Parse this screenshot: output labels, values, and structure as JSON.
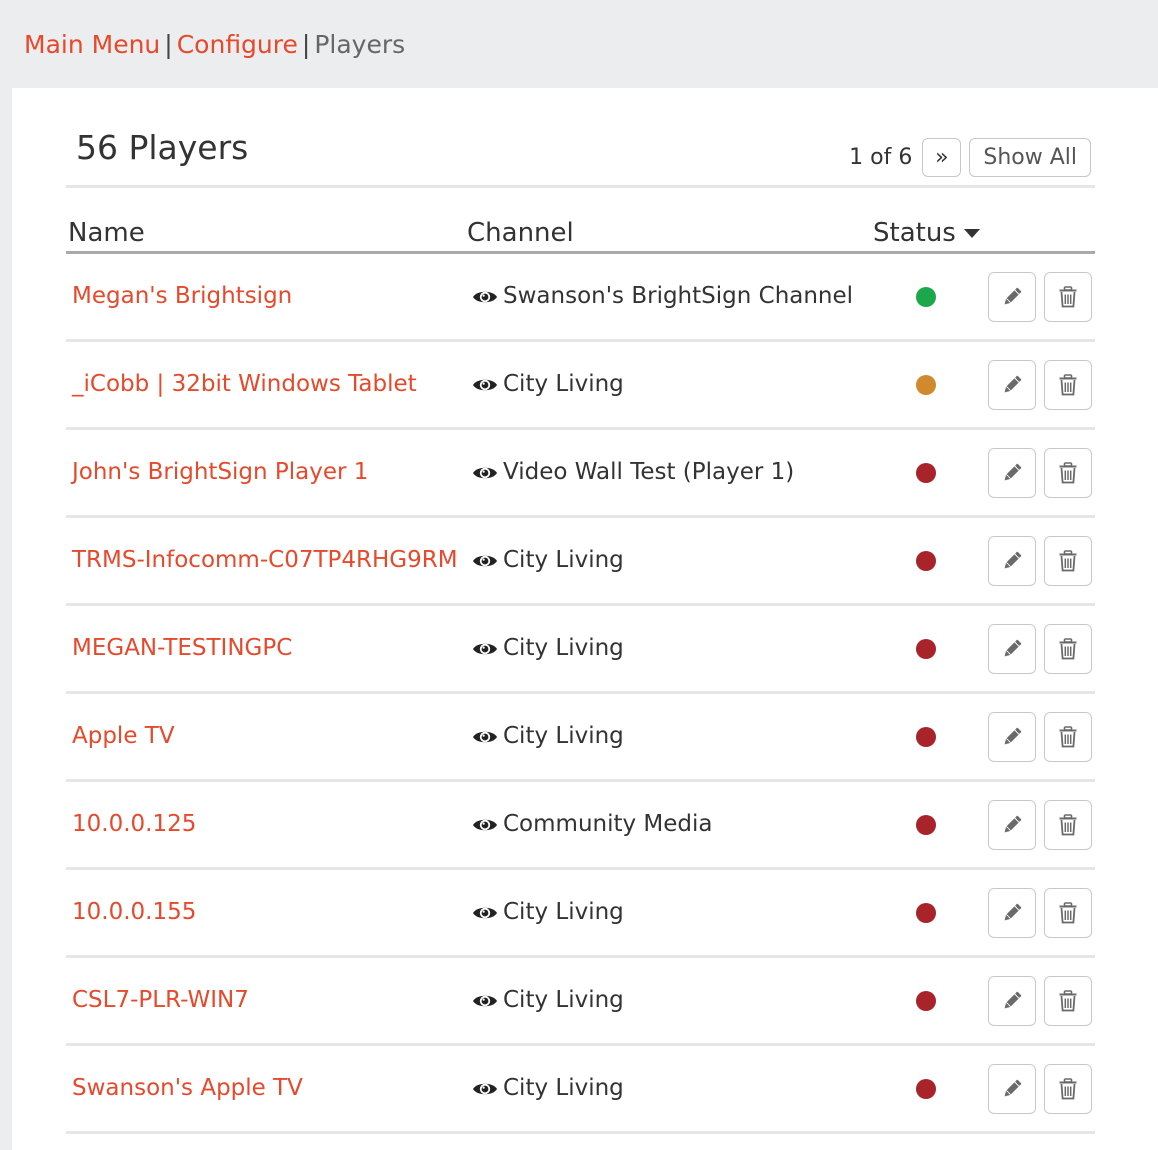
{
  "breadcrumb": {
    "main_menu": "Main Menu",
    "configure": "Configure",
    "current": "Players",
    "separator": "|"
  },
  "header": {
    "title": "56 Players",
    "page_info": "1 of 6",
    "next_label": "»",
    "show_all_label": "Show All"
  },
  "columns": {
    "name": "Name",
    "channel": "Channel",
    "status": "Status"
  },
  "status_colors": {
    "online": "#1ba74a",
    "warning": "#d0892d",
    "offline": "#a8232a"
  },
  "icons": {
    "channel": "eye-icon",
    "sort": "caret-down-icon",
    "edit": "pencil-icon",
    "delete": "trash-icon"
  },
  "players": [
    {
      "name": "Megan's Brightsign",
      "channel": "Swanson's BrightSign Channel",
      "status": "online"
    },
    {
      "name": "_iCobb | 32bit Windows Tablet",
      "channel": "City Living",
      "status": "warning"
    },
    {
      "name": "John's BrightSign Player 1",
      "channel": "Video Wall Test (Player 1)",
      "status": "offline"
    },
    {
      "name": "TRMS-Infocomm-C07TP4RHG9RM",
      "channel": "City Living",
      "status": "offline"
    },
    {
      "name": "MEGAN-TESTINGPC",
      "channel": "City Living",
      "status": "offline"
    },
    {
      "name": "Apple TV",
      "channel": "City Living",
      "status": "offline"
    },
    {
      "name": "10.0.0.125",
      "channel": "Community Media",
      "status": "offline"
    },
    {
      "name": "10.0.0.155",
      "channel": "City Living",
      "status": "offline"
    },
    {
      "name": "CSL7-PLR-WIN7",
      "channel": "City Living",
      "status": "offline"
    },
    {
      "name": "Swanson's Apple TV",
      "channel": "City Living",
      "status": "offline"
    }
  ]
}
